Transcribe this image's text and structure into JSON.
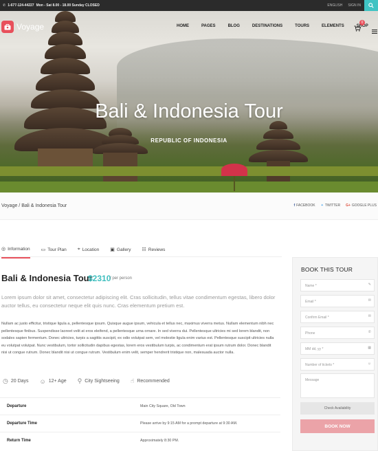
{
  "topbar": {
    "phone": "1-677-124-44227",
    "hours": "Mon - Sat 8.00 - 18.00 Sunday CLOSED",
    "language": "ENGLISH",
    "signin": "SIGN IN"
  },
  "brand": {
    "name": "Voyage",
    "accent": "#e8505b",
    "teal": "#3fc3c3"
  },
  "nav": {
    "items": [
      "HOME",
      "PAGES",
      "BLOG",
      "DESTINATIONS",
      "TOURS",
      "ELEMENTS",
      "SHOP"
    ],
    "cart_count": "0"
  },
  "hero": {
    "title": "Bali & Indonesia Tour",
    "subtitle": "REPUBLIC OF INDONESIA"
  },
  "breadcrumb": "Voyage / Bali & Indonesia Tour",
  "share": {
    "facebook": "FACEBOOK",
    "twitter": "TWITTER",
    "google": "GOOGLE PLUS"
  },
  "tabs": [
    "Information",
    "Tour Plan",
    "Location",
    "Gallery",
    "Reviews"
  ],
  "tour": {
    "title": "Bali & Indonesia Tour",
    "price": "$2310",
    "per": "/ per person",
    "lead": "Lorem ipsum dolor sit amet, consectetur adipiscing elit. Cras sollicitudin, tellus vitae condimentum egestas, libero dolor auctor tellus, eu consectetur neque elit quis nunc. Cras elementum pretium est.",
    "body": "Nullam ac justo efficitur, tristique ligula a, pellentesque ipsum. Quisque augue ipsum, vehicula et tellus nec, maximus viverra metus. Nullam elementum nibh nec pellentesque finibus. Suspendisse laoreet velit at eros eleifend, a pellentesque urna ornare. In sed viverra dui. Pellentesque ultricies mi sed lorem blandit, non sodales sapien fermentum. Donec ultricies, turpis a sagittis suscipit, ex odio volutpat sem, vel molestie ligula enim varius est. Pellentesque suscipit ultricies nulla eu volutpat volutpat. Nunc vestibulum, tortor sollicitudin dapibus egestas, lorem eros vestibulum turpis, ac condimentum erat ipsum rutrum dolor. Donec blandit nisi ut congue rutrum. Donec blandit nisi ut congue rutrum. Vestibulum enim velit, semper hendrerit tristique non, malesuada auctor nulla.",
    "features": [
      "20 Days",
      "12+ Age",
      "City Sightseeing",
      "Recommended"
    ],
    "info": [
      {
        "label": "Departure",
        "value": "Main City Square, Old Town"
      },
      {
        "label": "Departure Time",
        "value": "Please arrive by 9:15 AM for a prompt departure at 9:30 AM."
      },
      {
        "label": "Return Time",
        "value": "Approximately 8:30 PM."
      }
    ]
  },
  "booking": {
    "title": "BOOK THIS TOUR",
    "name": "Name *",
    "email": "Email *",
    "confirm_email": "Confirm Email *",
    "phone": "Phone",
    "date": "MM dd, yy *",
    "tickets": "Number of tickets *",
    "message": "Message",
    "check": "Check Availability",
    "book": "BOOK NOW"
  }
}
